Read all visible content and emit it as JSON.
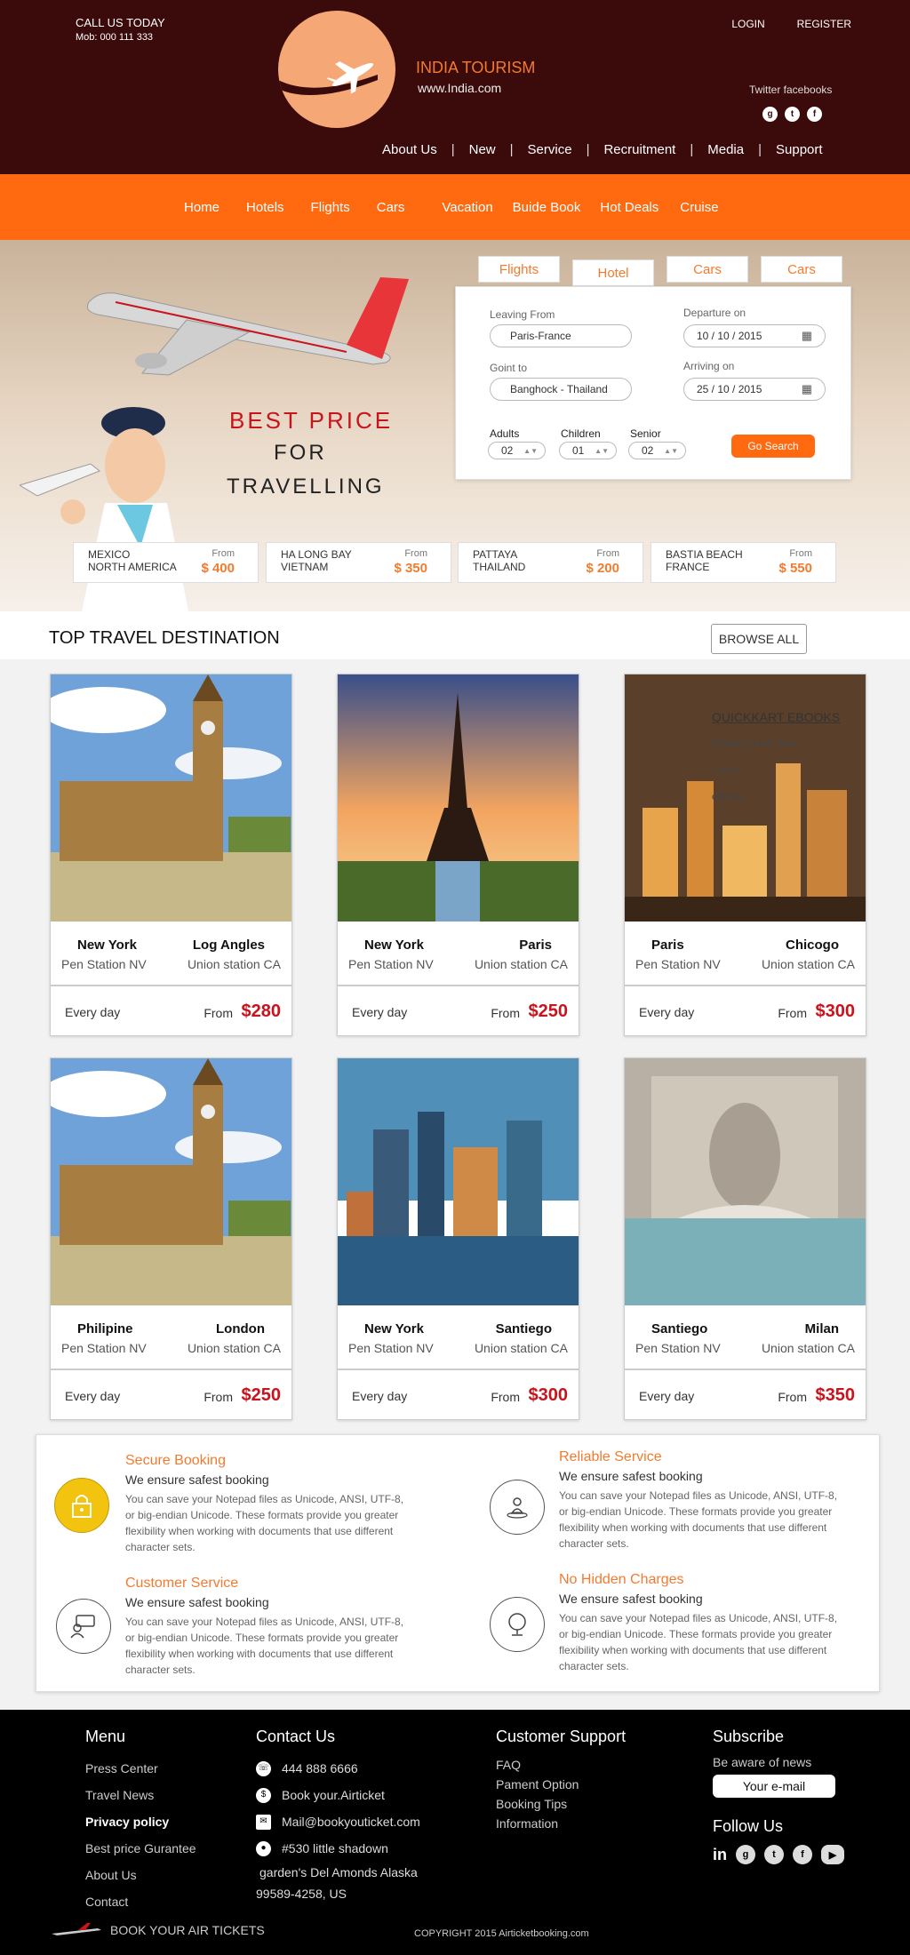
{
  "header": {
    "call_label": "CALL US TODAY",
    "mobile": "Mob: 000 111 333",
    "brand_name": "INDIA TOURISM",
    "brand_url": "www.India.com",
    "login": "LOGIN",
    "register": "REGISTER",
    "social_text": "Twitter facebooks",
    "nav": [
      "About Us",
      "New",
      "Service",
      "Recruitment",
      "Media",
      "Support"
    ]
  },
  "main_nav": [
    "Home",
    "Hotels",
    "Flights",
    "Cars",
    "Vacation",
    "Buide Book",
    "Hot Deals",
    "Cruise"
  ],
  "hero": {
    "line1": "BEST PRICE",
    "line2": "FOR",
    "line3": "TRAVELLING",
    "tabs": [
      "Flights",
      "Hotel",
      "Cars",
      "Cars"
    ],
    "form": {
      "leaving_label": "Leaving From",
      "leaving_value": "Paris-France",
      "going_label": "Goint to",
      "going_value": "Banghock - Thailand",
      "departure_label": "Departure on",
      "departure_value": "10 / 10 / 2015",
      "arriving_label": "Arriving  on",
      "arriving_value": "25 / 10 / 2015",
      "adults_label": "Adults",
      "adults_value": "02",
      "children_label": "Children",
      "children_value": "01",
      "senior_label": "Senior",
      "senior_value": "02",
      "search_button": "Go Search"
    },
    "destinations": [
      {
        "line1": "MEXICO",
        "line2": "NORTH AMERICA",
        "from": "From",
        "price": "$ 400"
      },
      {
        "line1": "HA LONG BAY",
        "line2": "VIETNAM",
        "from": "From",
        "price": "$ 350"
      },
      {
        "line1": "PATTAYA",
        "line2": "THAILAND",
        "from": "From",
        "price": "$ 200"
      },
      {
        "line1": "BASTIA BEACH",
        "line2": "FRANCE",
        "from": "From",
        "price": "$ 550"
      }
    ]
  },
  "top": {
    "title": "TOP TRAVEL DESTINATION",
    "browse": "BROWSE ALL",
    "overlay": {
      "title": "QUICKKART EBOOKS",
      "items": [
        "EBooks Quick Start",
        "Guide",
        "eBooks"
      ]
    },
    "cards": [
      {
        "city1": "New York",
        "sub1": "Pen Station NV",
        "city2": "Log Angles",
        "sub2": "Union station CA",
        "freq": "Every day",
        "from": "From",
        "price": "$280"
      },
      {
        "city1": "New York",
        "sub1": "Pen Station NV",
        "city2": "Paris",
        "sub2": "Union station CA",
        "freq": "Every day",
        "from": "From",
        "price": "$250"
      },
      {
        "city1": "Paris",
        "sub1": "Pen Station NV",
        "city2": "Chicogo",
        "sub2": "Union station CA",
        "freq": "Every day",
        "from": "From",
        "price": "$300"
      },
      {
        "city1": "Philipine",
        "sub1": "Pen Station NV",
        "city2": "London",
        "sub2": "Union station CA",
        "freq": "Every day",
        "from": "From",
        "price": "$250"
      },
      {
        "city1": "New York",
        "sub1": "Pen Station NV",
        "city2": "Santiego",
        "sub2": "Union station CA",
        "freq": "Every day",
        "from": "From",
        "price": "$300"
      },
      {
        "city1": "Santiego",
        "sub1": "Pen Station NV",
        "city2": "Milan",
        "sub2": "Union station CA",
        "freq": "Every day",
        "from": "From",
        "price": "$350"
      }
    ]
  },
  "features": [
    {
      "title": "Secure Booking",
      "sub": "We ensure safest booking",
      "desc": "You can save your Notepad files as Unicode, ANSI, UTF-8, or big-endian Unicode. These formats provide you greater flexibility when working with documents that use different character sets.",
      "icon": "lock-icon"
    },
    {
      "title": "Reliable Service",
      "sub": "We ensure safest booking",
      "desc": "You can save your Notepad files as Unicode, ANSI, UTF-8, or big-endian Unicode. These formats provide you greater flexibility when working with documents that use different character sets.",
      "icon": "person-icon"
    },
    {
      "title": "Customer Service",
      "sub": "We ensure safest booking",
      "desc": "You can save your Notepad files as Unicode, ANSI, UTF-8, or big-endian Unicode. These formats provide you greater flexibility when working with documents that use different character sets.",
      "icon": "chat-icon"
    },
    {
      "title": "No Hidden Charges",
      "sub": "We ensure safest booking",
      "desc": "You can save your Notepad files as Unicode, ANSI, UTF-8, or big-endian Unicode. These formats provide you greater flexibility when working with documents that use different character sets.",
      "icon": "globe-icon"
    }
  ],
  "footer": {
    "menu_title": "Menu",
    "menu": [
      "Press Center",
      "Travel News",
      "Privacy policy",
      "Best price Gurantee",
      "About Us",
      "Contact"
    ],
    "contact_title": "Contact Us",
    "phone": "444 888 6666",
    "book": "Book your.Airticket",
    "mail": "Mail@bookyouticket.com",
    "address1": "#530 little shadown",
    "address2": "garden's Del Amonds Alaska",
    "address3": "99589-4258, US",
    "support_title": "Customer Support",
    "support": [
      "FAQ",
      "Pament Option",
      "Booking Tips",
      "Information"
    ],
    "subscribe_title": "Subscribe",
    "subscribe_text": "Be aware of news",
    "email_placeholder": "Your e-mail",
    "follow_title": "Follow Us",
    "book_air": "BOOK YOUR AIR TICKETS",
    "copyright": "COPYRIGHT 2015 Airticketbooking.com"
  },
  "colors": {
    "maroon": "#3b0a0a",
    "orange": "#ff6a11",
    "accent": "#f37b2f",
    "price": "#c8141c"
  }
}
